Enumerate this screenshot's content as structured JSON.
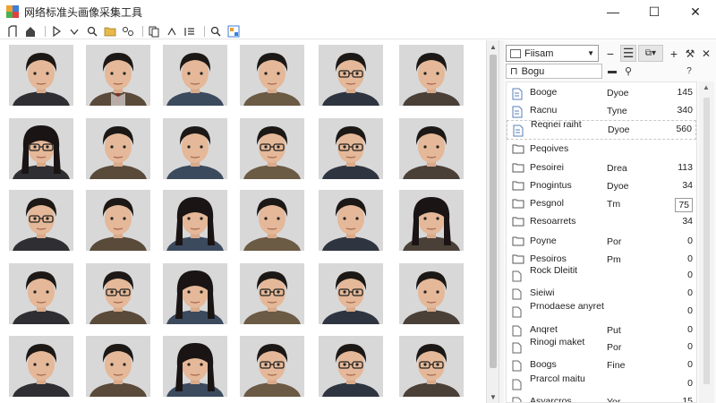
{
  "window": {
    "title": "网络标准头画像采集工具",
    "controls": {
      "minimize": "—",
      "maximize": "☐",
      "close": "✕"
    },
    "accent_colors": [
      "#f0a030",
      "#3d7fd9",
      "#4caf50",
      "#e04040"
    ]
  },
  "toolbar": {
    "icons": [
      "new-document-icon",
      "house-icon",
      "play-icon",
      "chevron-down-icon",
      "magnifier-icon",
      "folder-icon",
      "link-icon",
      "copy-icon",
      "caret-up-icon",
      "list-icon",
      "search-icon",
      "image-tool-icon"
    ]
  },
  "gallery": {
    "rows": [
      [
        "male",
        "male-suit",
        "male",
        "male",
        "male-glasses",
        "male"
      ],
      [
        "female-glasses",
        "male",
        "male",
        "male-glasses",
        "male-glasses",
        "male"
      ],
      [
        "male-glasses",
        "male",
        "female",
        "male",
        "male",
        "female"
      ],
      [
        "male",
        "male-glasses",
        "female",
        "male-glasses",
        "male-glasses",
        "male"
      ],
      [
        "male",
        "male",
        "female",
        "male-glasses",
        "male-glasses",
        "male-glasses"
      ]
    ]
  },
  "panel": {
    "view_select": "Fiisam",
    "search_value": "Bogu",
    "buttons": {
      "minus": "−",
      "equals": "☰",
      "add": "+",
      "wrench": "⚒",
      "close": "✕"
    },
    "items": [
      {
        "icon": "document-blue-icon",
        "name": "Booge",
        "type": "Dyoe",
        "size": "145",
        "style": ""
      },
      {
        "icon": "document-blue-icon",
        "name": "Racnu",
        "type": "Tyne",
        "size": "340",
        "style": ""
      },
      {
        "icon": "document-blue-icon",
        "name": "Reqnei raiht",
        "type": "Dyoe",
        "size": "560",
        "style": "hl"
      },
      {
        "icon": "folder-icon",
        "name": "Peqoives",
        "type": "",
        "size": "",
        "style": ""
      },
      {
        "icon": "folder-icon",
        "name": "Pesoirei",
        "type": "Drea",
        "size": "113",
        "style": ""
      },
      {
        "icon": "folder-icon",
        "name": "Pnogintus",
        "type": "Dyoe",
        "size": "34",
        "style": ""
      },
      {
        "icon": "folder-icon",
        "name": "Pesgnol",
        "type": "Tm",
        "size": "75",
        "style": "box"
      },
      {
        "icon": "folder-icon",
        "name": "Resoarrets",
        "type": "",
        "size": "34",
        "style": ""
      },
      {
        "icon": "folder-icon",
        "name": "Poyne",
        "type": "Por",
        "size": "0",
        "style": ""
      },
      {
        "icon": "folder-icon",
        "name": "Pesoiros",
        "type": "Pm",
        "size": "0",
        "style": ""
      },
      {
        "icon": "page-icon",
        "name": "Rock Dleitit",
        "type": "",
        "size": "0",
        "style": ""
      },
      {
        "icon": "page-icon",
        "name": "Sieiwi",
        "type": "",
        "size": "0",
        "style": ""
      },
      {
        "icon": "page-icon",
        "name": "Prnodaese anyret",
        "type": "",
        "size": "0",
        "style": ""
      },
      {
        "icon": "page-icon",
        "name": "Anqret",
        "type": "Put",
        "size": "0",
        "style": ""
      },
      {
        "icon": "page-icon",
        "name": "Rinogi maket",
        "type": "Por",
        "size": "0",
        "style": ""
      },
      {
        "icon": "page-icon",
        "name": "Boogs",
        "type": "Fine",
        "size": "0",
        "style": ""
      },
      {
        "icon": "page-icon",
        "name": "Prarcol maitu",
        "type": "",
        "size": "0",
        "style": ""
      },
      {
        "icon": "page-icon",
        "name": "Asyarcros",
        "type": "Yor",
        "size": "15",
        "style": ""
      }
    ]
  }
}
